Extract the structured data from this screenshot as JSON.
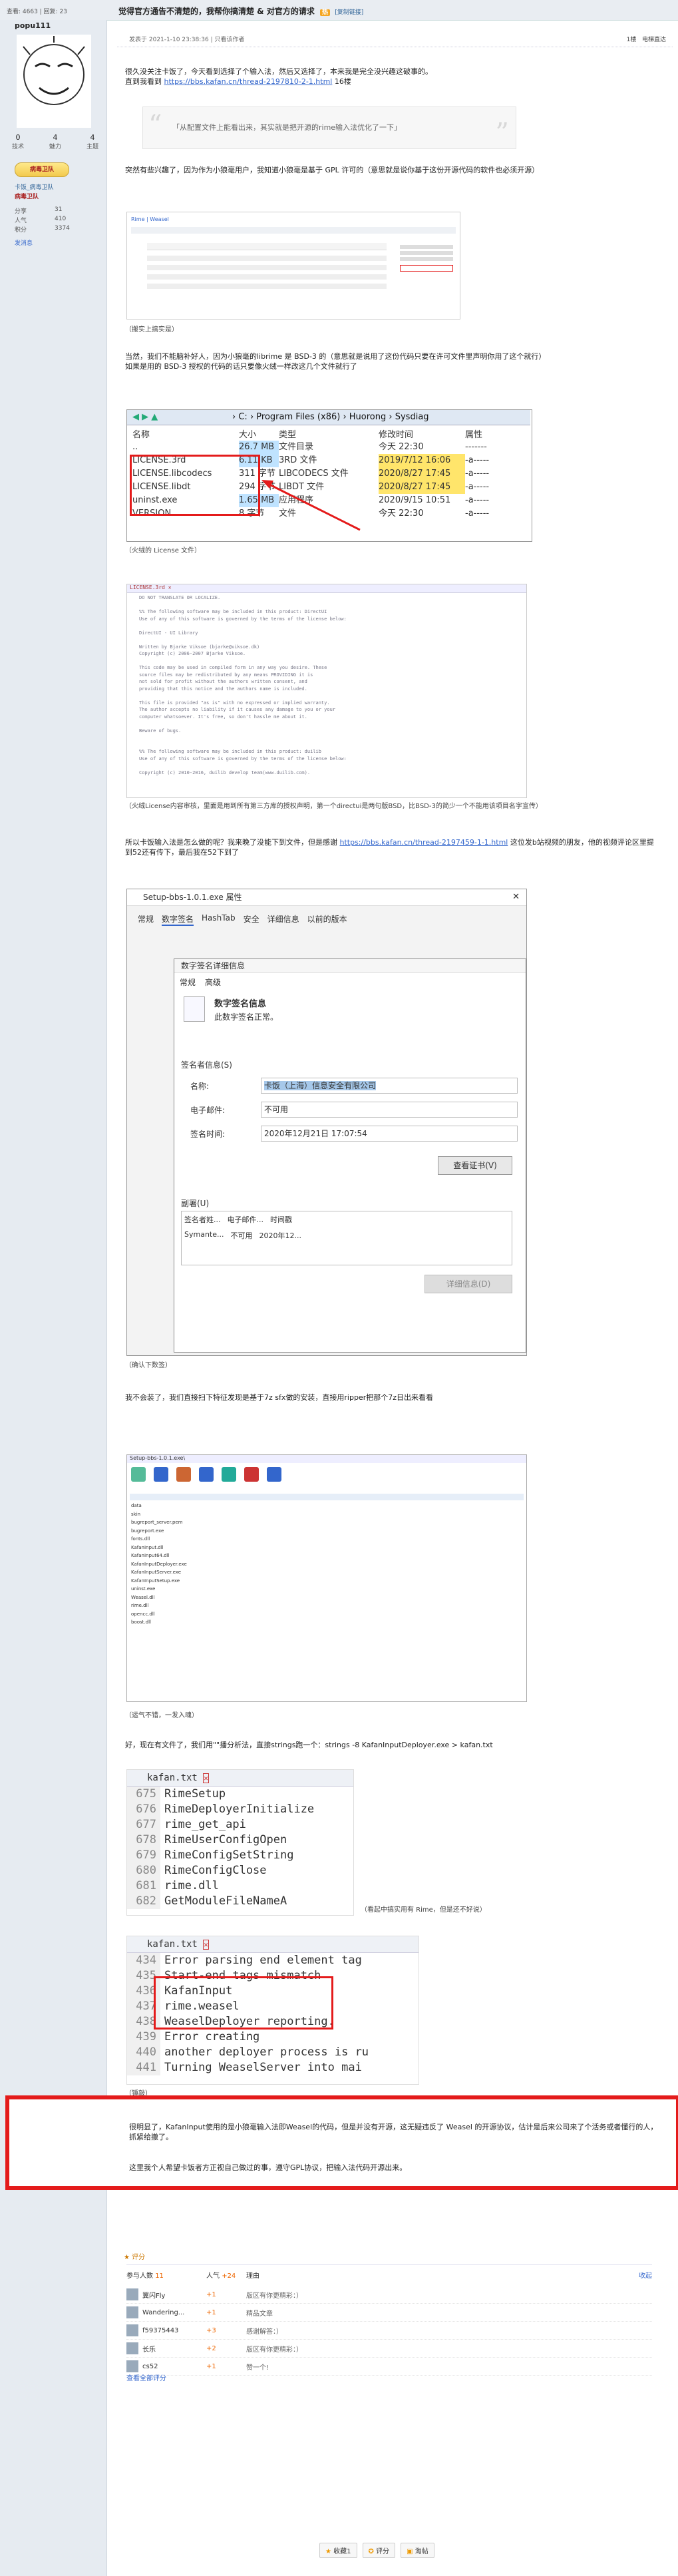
{
  "header": {
    "stats": "查看: 4663 | 回复: 23",
    "title": "觉得官方通告不清楚的，我帮你搞清楚 & 对官方的请求",
    "tag": "热",
    "copy_link": "[复制链接]"
  },
  "author": {
    "name": "popu111",
    "stats": [
      {
        "label": "技术",
        "value": "0"
      },
      {
        "label": "魅力",
        "value": "4"
      },
      {
        "label": "主题",
        "value": "4"
      }
    ],
    "medal": "病毒卫队",
    "team": "卡饭_病毒卫队",
    "level": "病毒卫队",
    "fields": [
      {
        "k": "分享",
        "v": "31"
      },
      {
        "k": "人气",
        "v": "410"
      },
      {
        "k": "积分",
        "v": "3374"
      }
    ],
    "pm": "发消息"
  },
  "post_meta": {
    "posted": "发表于 2021-1-10 23:38:36 | 只看该作者",
    "floor": "1楼",
    "right": "电梯直达"
  },
  "body": {
    "p1": "很久没关注卡饭了，今天看到选择了个输入法，然后又选择了，本来我是完全没兴趣这破事的。",
    "p1b": "直到我看到 ",
    "link1": "https://bbs.kafan.cn/thread-2197810-2-1.html",
    "p1c": " 16楼",
    "quote": "「从配置文件上能看出来，其实就是把开源的rime输入法优化了一下」",
    "p2": "突然有些兴趣了，因为作为小狼毫用户，我知道小狼毫是基于 GPL 许可的（意思就是说你基于这份开源代码的软件也必须开源）",
    "cap1": "（搬实上搞实是）",
    "p3": "当然，我们不能脑补好人，因为小狼毫的librime 是 BSD-3 的（意思就是说用了这份代码只要在许可文件里声明你用了这个就行）",
    "p3b": "如果是用的 BSD-3 授权的代码的话只要像火绒一样改这几个文件就行了",
    "cap2": "（火绒的 License 文件）",
    "cap3": "（火绒License内容审核，里面是用到所有第三方库的授权声明，第一个directui是两句版BSD，比BSD-3的简少一个不能用该项目名字宣传）",
    "p4a": "所以卡饭输入法是怎么做的呢？我来晚了没能下到文件，但是感谢 ",
    "link2": "https://bbs.kafan.cn/thread-2197459-1-1.html",
    "p4b": " 这位发b站视频的朋友，他的视频评论区里提到52还有传下，最后我在52下到了",
    "cap4": "（确认下数签）",
    "p5": "我不会装了，我们直接扫下特征发现是基于7z sfx做的安装，直接用ripper把那个7z日出来看看",
    "cap5": "（运气不错，一发入魂）",
    "p6": "好，现在有文件了，我们用\"\"播分析法，直接strings跑一个：strings -8 KafanInputDeployer.exe > kafan.txt",
    "cap6": "（看起中搞实用有 Rime，但是还不好说）",
    "cap7": "（锤敲）",
    "red1": "很明显了，KafanInput使用的是小狼毫输入法即Weasel的代码，但是并没有开源，这无疑违反了 Weasel 的开源协议，估计是后来公司来了个活务或者懂行的人，抓紧给撤了。",
    "red2": "这里我个人希望卡饭者方正视自己做过的事，遵守GPL协议，把输入法代码开源出来。"
  },
  "shot1": {
    "title": "Rime | Weasel",
    "tabs": [
      "Name",
      "Description",
      "Company"
    ]
  },
  "explorer": {
    "path": [
      "C:",
      "Program Files (x86)",
      "Huorong",
      "Sysdiag"
    ],
    "columns": [
      "名称",
      "大小",
      "类型",
      "修改时间",
      "属性"
    ],
    "rows": [
      {
        "name": "..",
        "size": "26.7 MB",
        "type": "文件目录",
        "date": "今天 22:30",
        "attr": "-------"
      },
      {
        "name": "LICENSE.3rd",
        "size": "6.11 KB",
        "type": "3RD 文件",
        "date": "2019/7/12 16:06",
        "attr": "-a-----"
      },
      {
        "name": "LICENSE.libcodecs",
        "size": "311 字节",
        "type": "LIBCODECS 文件",
        "date": "2020/8/27 17:45",
        "attr": "-a-----"
      },
      {
        "name": "LICENSE.libdt",
        "size": "294 字节",
        "type": "LIBDT 文件",
        "date": "2020/8/27 17:45",
        "attr": "-a-----"
      },
      {
        "name": "uninst.exe",
        "size": "1.65 MB",
        "type": "应用程序",
        "date": "2020/9/15 10:51",
        "attr": "-a-----"
      },
      {
        "name": "VERSION",
        "size": "8 字节",
        "type": "文件",
        "date": "今天 22:30",
        "attr": "-a-----"
      }
    ]
  },
  "license_text": [
    "DO NOT TRANSLATE OR LOCALIZE.",
    "",
    "%% The following software may be included in this product: DirectUI",
    "Use of any of this software is governed by the terms of the license below:",
    "",
    "DirectUI - UI Library",
    "",
    "Written by Bjarke Viksoe (bjarke@viksoe.dk)",
    "Copyright (c) 2006-2007 Bjarke Viksoe.",
    "",
    "This code may be used in compiled form in any way you desire. These",
    "source files may be redistributed by any means PROVIDING it is",
    "not sold for profit without the authors written consent, and",
    "providing that this notice and the authors name is included.",
    "",
    "This file is provided \"as is\" with no expressed or implied warranty.",
    "The author accepts no liability if it causes any damage to you or your",
    "computer whatsoever. It's free, so don't hassle me about it.",
    "",
    "Beware of bugs.",
    "",
    "",
    "%% The following software may be included in this product: duilib",
    "Use of any of this software is governed by the terms of the license below:",
    "",
    "Copyright (c) 2010-2016, duilib develop team(www.duilib.com)."
  ],
  "sig": {
    "title": "Setup-bbs-1.0.1.exe 属性",
    "tabs": [
      "常规",
      "数字签名",
      "HashTab",
      "安全",
      "详细信息",
      "以前的版本"
    ],
    "inner_title": "数字签名详细信息",
    "inner_tabs": [
      "常规",
      "高级"
    ],
    "info_title": "数字签名信息",
    "info_sub": "此数字签名正常。",
    "signer_label": "签名者信息(S)",
    "name_label": "名称:",
    "name_value": "卡饭（上海）信息安全有限公司",
    "email_label": "电子邮件:",
    "email_value": "不可用",
    "time_label": "签名时间:",
    "time_value": "2020年12月21日 17:07:54",
    "view_cert": "查看证书(V)",
    "counter_label": "副署(U)",
    "counter_cols": [
      "签名者姓...",
      "电子邮件...",
      "时间戳"
    ],
    "counter_row": [
      "Symante...",
      "不可用",
      "2020年12..."
    ],
    "details": "详细信息(D)"
  },
  "zip": {
    "title": "Setup-bbs-1.0.1.exe\\",
    "files": [
      "data",
      "skin",
      "bugreport_server.pem",
      "bugreport.exe",
      "fonts.dll",
      "KafanInput.dll",
      "KafanInput64.dll",
      "KafanInputDeployer.exe",
      "KafanInputServer.exe",
      "KafanInputSetup.exe",
      "uninst.exe",
      "Weasel.dll",
      "rime.dll",
      "opencc.dll",
      "boost.dll"
    ]
  },
  "code1": {
    "tab": "kafan.txt",
    "lines": [
      {
        "n": "675",
        "t": "RimeSetup"
      },
      {
        "n": "676",
        "t": "RimeDeployerInitialize"
      },
      {
        "n": "677",
        "t": "rime_get_api"
      },
      {
        "n": "678",
        "t": "RimeUserConfigOpen"
      },
      {
        "n": "679",
        "t": "RimeConfigSetString"
      },
      {
        "n": "680",
        "t": "RimeConfigClose"
      },
      {
        "n": "681",
        "t": "rime.dll"
      },
      {
        "n": "682",
        "t": "GetModuleFileNameA"
      }
    ]
  },
  "code2": {
    "tab": "kafan.txt",
    "lines": [
      {
        "n": "434",
        "t": "Error parsing end element tag"
      },
      {
        "n": "435",
        "t": "Start-end tags mismatch"
      },
      {
        "n": "436",
        "t": "KafanInput"
      },
      {
        "n": "437",
        "t": "rime.weasel"
      },
      {
        "n": "438",
        "t": "WeaselDeployer reporting."
      },
      {
        "n": "439",
        "t": "Error creating"
      },
      {
        "n": "440",
        "t": "another deployer process is ru"
      },
      {
        "n": "441",
        "t": "Turning WeaselServer into mai"
      }
    ]
  },
  "rating": {
    "header": "评分",
    "cols": [
      "参与人数",
      "人气",
      "理由"
    ],
    "count": "11",
    "pop": "+24",
    "collapse": "收起",
    "rows": [
      {
        "user": "翼闪Fly",
        "pop": "+1",
        "reason": "版区有你更精彩：）"
      },
      {
        "user": "Wandering...",
        "pop": "+1",
        "reason": "精品文章"
      },
      {
        "user": "f59375443",
        "pop": "+3",
        "reason": "感谢解答：）"
      },
      {
        "user": "长乐",
        "pop": "+2",
        "reason": "版区有你更精彩：）"
      },
      {
        "user": "cs52",
        "pop": "+1",
        "reason": "赞一个!"
      }
    ],
    "all": "查看全部评分"
  },
  "actions": [
    "收藏1",
    "评分",
    "淘帖"
  ],
  "colors": {
    "red": "#e41b1b",
    "link": "#3366cc",
    "sidebar": "#e6ebf1"
  }
}
